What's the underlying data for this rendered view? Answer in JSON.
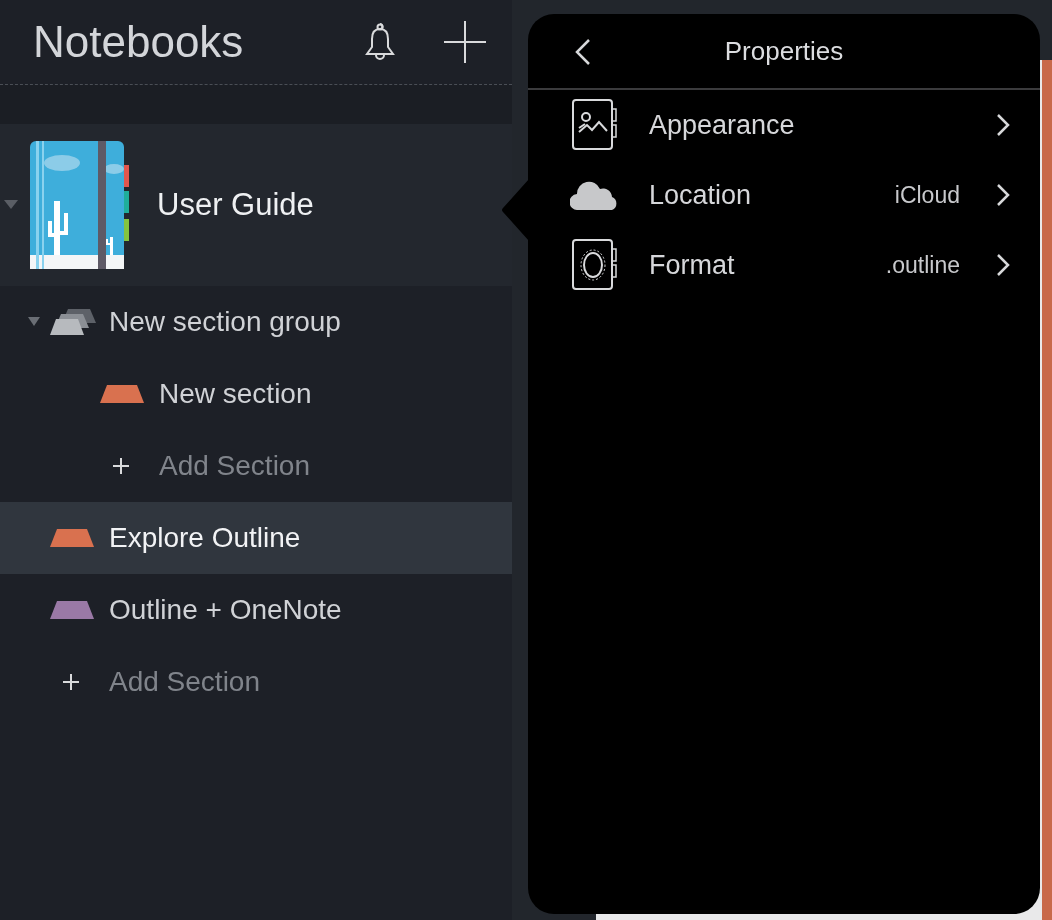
{
  "sidebar": {
    "title": "Notebooks",
    "notebook": {
      "name": "User Guide",
      "expanded": true
    },
    "items": [
      {
        "kind": "group",
        "label": "New section group",
        "expanded": true,
        "selected": false,
        "children": [
          {
            "kind": "section",
            "label": "New section",
            "color": "#d9714f",
            "selected": false
          },
          {
            "kind": "add",
            "label": "Add Section"
          }
        ]
      },
      {
        "kind": "section",
        "label": "Explore Outline",
        "color": "#d9714f",
        "selected": true
      },
      {
        "kind": "section",
        "label": "Outline + OneNote",
        "color": "#9a79a6",
        "selected": false
      },
      {
        "kind": "add",
        "label": "Add Section"
      }
    ]
  },
  "popover": {
    "title": "Properties",
    "rows": [
      {
        "kind": "appearance",
        "label": "Appearance"
      },
      {
        "kind": "location",
        "label": "Location",
        "value": "iCloud"
      },
      {
        "kind": "format",
        "label": "Format",
        "value": ".outline"
      }
    ]
  }
}
